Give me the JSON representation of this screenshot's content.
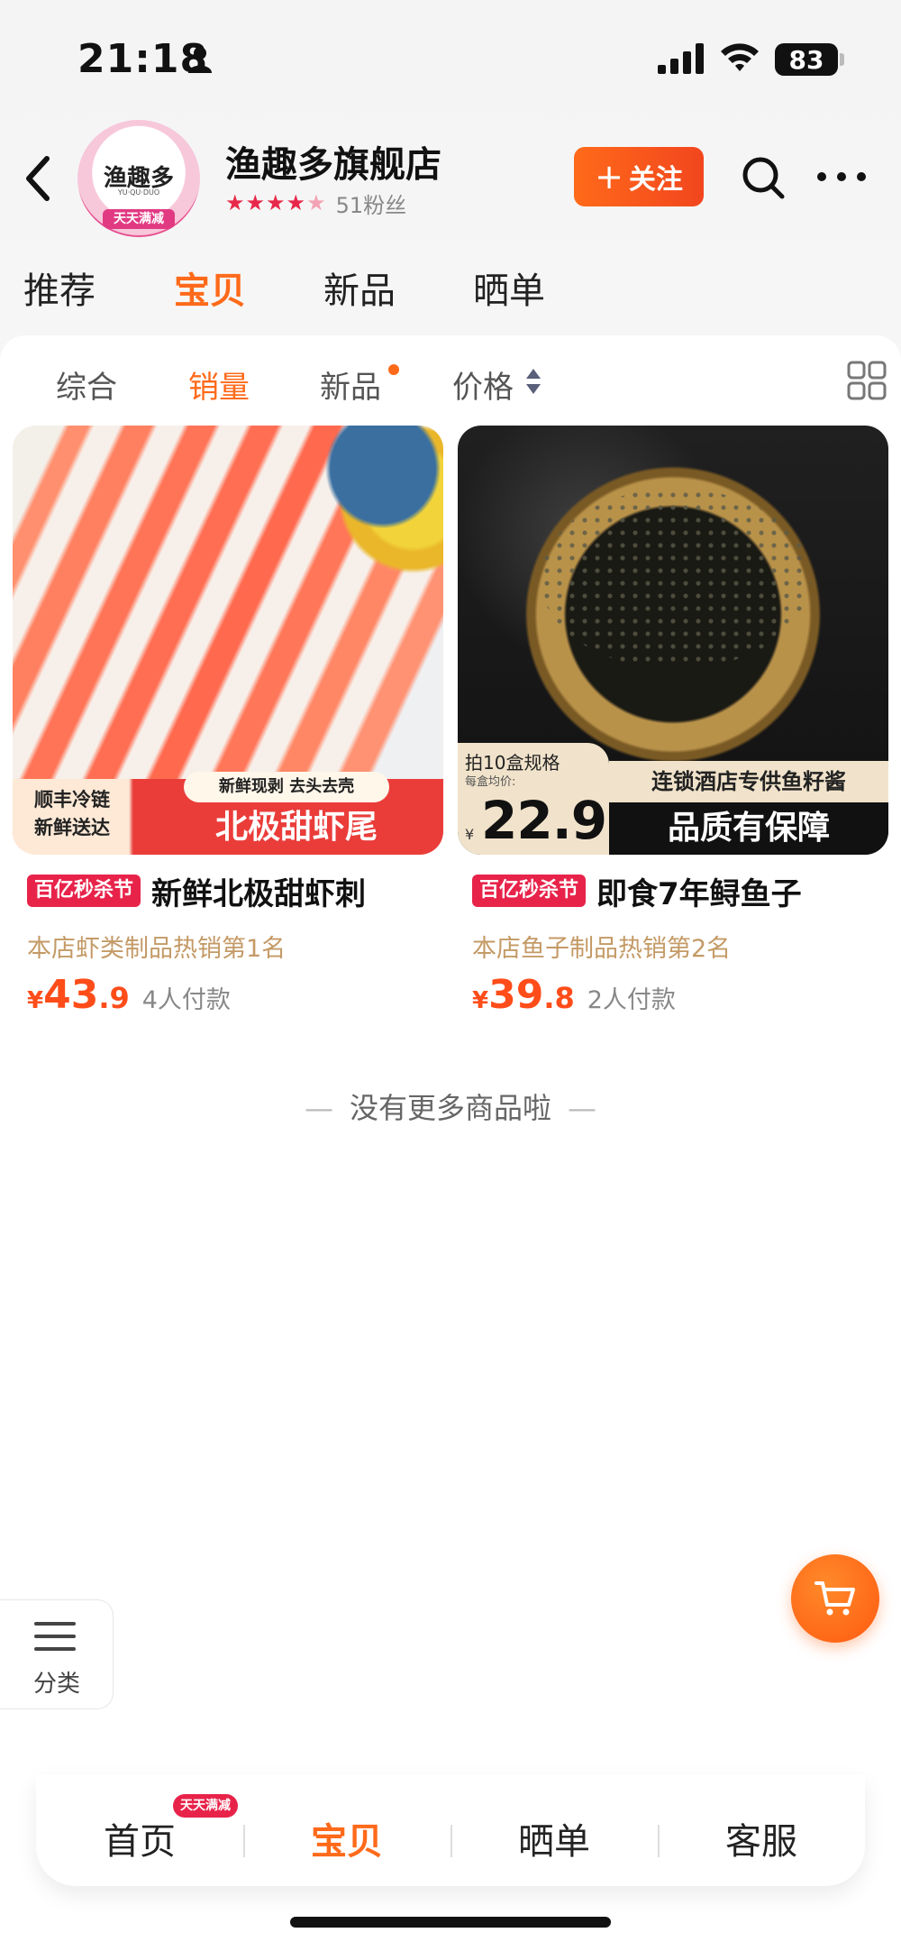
{
  "status_bar": {
    "time": "21:18",
    "battery": "83"
  },
  "shop": {
    "logo_text": "渔趣多",
    "logo_sub": "YU·QU·DUO",
    "logo_banner": "天天满减",
    "name": "渔趣多旗舰店",
    "stars": "★★★★",
    "star_half": "★",
    "fans": "51粉丝",
    "follow_label": "关注",
    "follow_plus": "+"
  },
  "shop_tabs": [
    "推荐",
    "宝贝",
    "新品",
    "晒单"
  ],
  "sort_tabs": [
    "综合",
    "销量",
    "新品",
    "价格"
  ],
  "products": [
    {
      "promo": "百亿秒杀节",
      "title": "新鲜北极甜虾刺",
      "rank": "本店虾类制品热销第1名",
      "yen": "¥",
      "price_int": "43",
      "price_dec": ".9",
      "sold": "4人付款",
      "image_badge_left": "顺丰冷链 新鲜送达",
      "image_badge_pill": "新鲜现剥 去头去壳",
      "image_badge_main": "北极甜虾尾"
    },
    {
      "promo": "百亿秒杀节",
      "title": "即食7年鲟鱼子",
      "rank": "本店鱼子制品热销第2名",
      "yen": "¥",
      "price_int": "39",
      "price_dec": ".8",
      "sold": "2人付款",
      "image_spec": "拍10盒规格",
      "image_avg": "每盒均价:",
      "image_price": "22.9",
      "image_yen": "¥",
      "image_tag_top": "连锁酒店专供鱼籽酱",
      "image_tag_main": "品质有保障"
    }
  ],
  "end_text": "没有更多商品啦",
  "end_dash": "—",
  "category_label": "分类",
  "bottom_tabs": [
    "首页",
    "宝贝",
    "晒单",
    "客服"
  ],
  "home_badge": "天天满减",
  "colors": {
    "accent": "#ff6a1a",
    "promo": "#e8234a",
    "rank": "#c49a66"
  }
}
